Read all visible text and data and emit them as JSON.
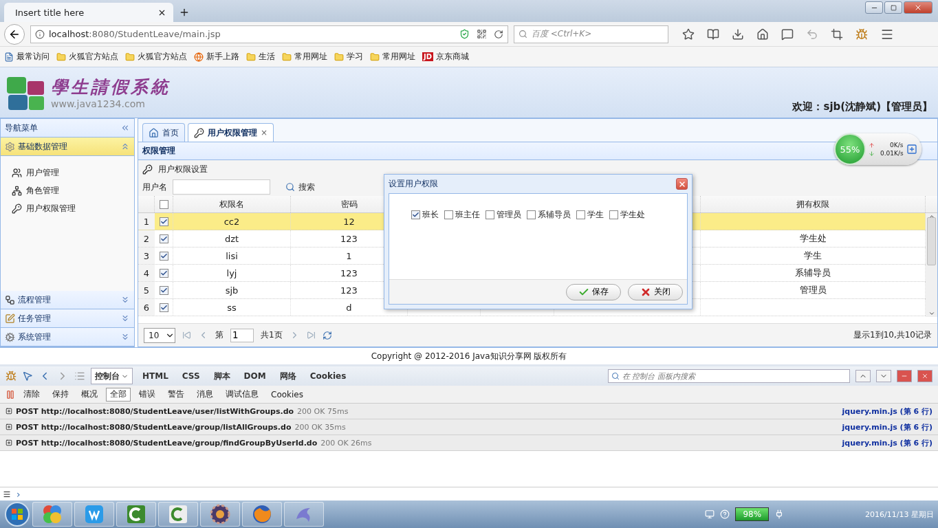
{
  "browser": {
    "tab_title": "Insert title here",
    "url_host": "localhost",
    "url_path": ":8080/StudentLeave/main.jsp",
    "search_placeholder": "百度 <Ctrl+K>",
    "bookmarks": [
      {
        "kind": "page",
        "label": "最常访问"
      },
      {
        "kind": "folder",
        "label": "火狐官方站点"
      },
      {
        "kind": "folder",
        "label": "火狐官方站点"
      },
      {
        "kind": "browser",
        "label": "新手上路"
      },
      {
        "kind": "folder",
        "label": "生活"
      },
      {
        "kind": "folder",
        "label": "常用网址"
      },
      {
        "kind": "folder",
        "label": "学习"
      },
      {
        "kind": "folder",
        "label": "常用网址"
      },
      {
        "kind": "jd",
        "badge": "JD",
        "label": "京东商城"
      }
    ]
  },
  "header": {
    "title": "學生請假系統",
    "site": "www.java1234.com",
    "welcome": "欢迎：sjb(沈静斌)【管理员】"
  },
  "nav": {
    "title": "导航菜单",
    "groups": [
      {
        "kind": "gear",
        "label": "基础数据管理",
        "expanded": true,
        "items": [
          {
            "kind": "users",
            "label": "用户管理"
          },
          {
            "kind": "roles",
            "label": "角色管理"
          },
          {
            "kind": "key",
            "label": "用户权限管理"
          }
        ]
      },
      {
        "kind": "flow",
        "label": "流程管理",
        "expanded": false
      },
      {
        "kind": "task",
        "label": "任务管理",
        "expanded": false
      },
      {
        "kind": "system",
        "label": "系统管理",
        "expanded": false
      }
    ]
  },
  "tabs": [
    {
      "kind": "home",
      "label": "首页",
      "selected": false
    },
    {
      "kind": "key",
      "label": "用户权限管理",
      "selected": true,
      "close": "×"
    }
  ],
  "panel": {
    "title": "权限管理",
    "toolbar_title": "用户权限设置",
    "search_label": "用户名",
    "search_button": "搜索"
  },
  "table": {
    "all_checked": false,
    "columns": [
      "权限名",
      "密码",
      "拥有权限"
    ],
    "rows": [
      {
        "num": "1",
        "checked": true,
        "selected": true,
        "name": "cc2",
        "password": "12"
      },
      {
        "num": "2",
        "checked": true,
        "selected": false,
        "name": "dzt",
        "password": "123",
        "permissions": "学生处"
      },
      {
        "num": "3",
        "checked": true,
        "selected": false,
        "name": "lisi",
        "password": "1",
        "permissions": "学生"
      },
      {
        "num": "4",
        "checked": true,
        "selected": false,
        "name": "lyj",
        "password": "123",
        "permissions": "系辅导员"
      },
      {
        "num": "5",
        "checked": true,
        "selected": false,
        "name": "sjb",
        "password": "123",
        "permissions": "管理员"
      },
      {
        "num": "6",
        "checked": true,
        "selected": false,
        "name": "ss",
        "password": "d"
      }
    ]
  },
  "pager": {
    "page_size": "10",
    "page_prefix": "第",
    "page": "1",
    "page_total": "共1页",
    "summary": "显示1到10,共10记录"
  },
  "dialog": {
    "title": "设置用户权限",
    "options": [
      {
        "label": "班长",
        "checked": true
      },
      {
        "label": "班主任",
        "checked": false
      },
      {
        "label": "管理员",
        "checked": false
      },
      {
        "label": "系辅导员",
        "checked": false
      },
      {
        "label": "学生",
        "checked": false
      },
      {
        "label": "学生处",
        "checked": false
      }
    ],
    "buttons": [
      {
        "kind": "save",
        "label": "保存"
      },
      {
        "kind": "close",
        "label": "关闭"
      }
    ]
  },
  "footer": "Copyright @ 2012-2016 Java知识分享网 版权所有",
  "monitor": {
    "percent": "55%",
    "up": "0K/s",
    "down": "0.01K/s"
  },
  "devtools": {
    "tabs": [
      {
        "label": "控制台",
        "selected": true
      },
      {
        "label": "HTML",
        "selected": false
      },
      {
        "label": "CSS",
        "selected": false
      },
      {
        "label": "脚本",
        "selected": false
      },
      {
        "label": "DOM",
        "selected": false
      },
      {
        "label": "网络",
        "selected": false
      },
      {
        "label": "Cookies",
        "selected": false
      }
    ],
    "search_placeholder": "在 控制台 面板内搜索",
    "actions": [
      "清除",
      "保持",
      "概况"
    ],
    "filters": [
      {
        "label": "全部",
        "selected": true
      },
      {
        "label": "错误",
        "selected": false
      },
      {
        "label": "警告",
        "selected": false
      },
      {
        "label": "消息",
        "selected": false
      },
      {
        "label": "调试信息",
        "selected": false
      },
      {
        "label": "Cookies",
        "selected": false
      }
    ],
    "logs": [
      {
        "method": "POST",
        "url": "http://localhost:8080/StudentLeave/user/listWithGroups.do",
        "status": "200 OK 75ms",
        "source": "jquery.min.js (第 6 行)"
      },
      {
        "method": "POST",
        "url": "http://localhost:8080/StudentLeave/group/listAllGroups.do",
        "status": "200 OK 35ms",
        "source": "jquery.min.js (第 6 行)"
      },
      {
        "method": "POST",
        "url": "http://localhost:8080/StudentLeave/group/findGroupByUserId.do",
        "status": "200 OK 26ms",
        "source": "jquery.min.js (第 6 行)"
      }
    ],
    "prompt": "›"
  },
  "taskbar": {
    "battery": "98%",
    "date": "2016/11/13 星期日"
  }
}
